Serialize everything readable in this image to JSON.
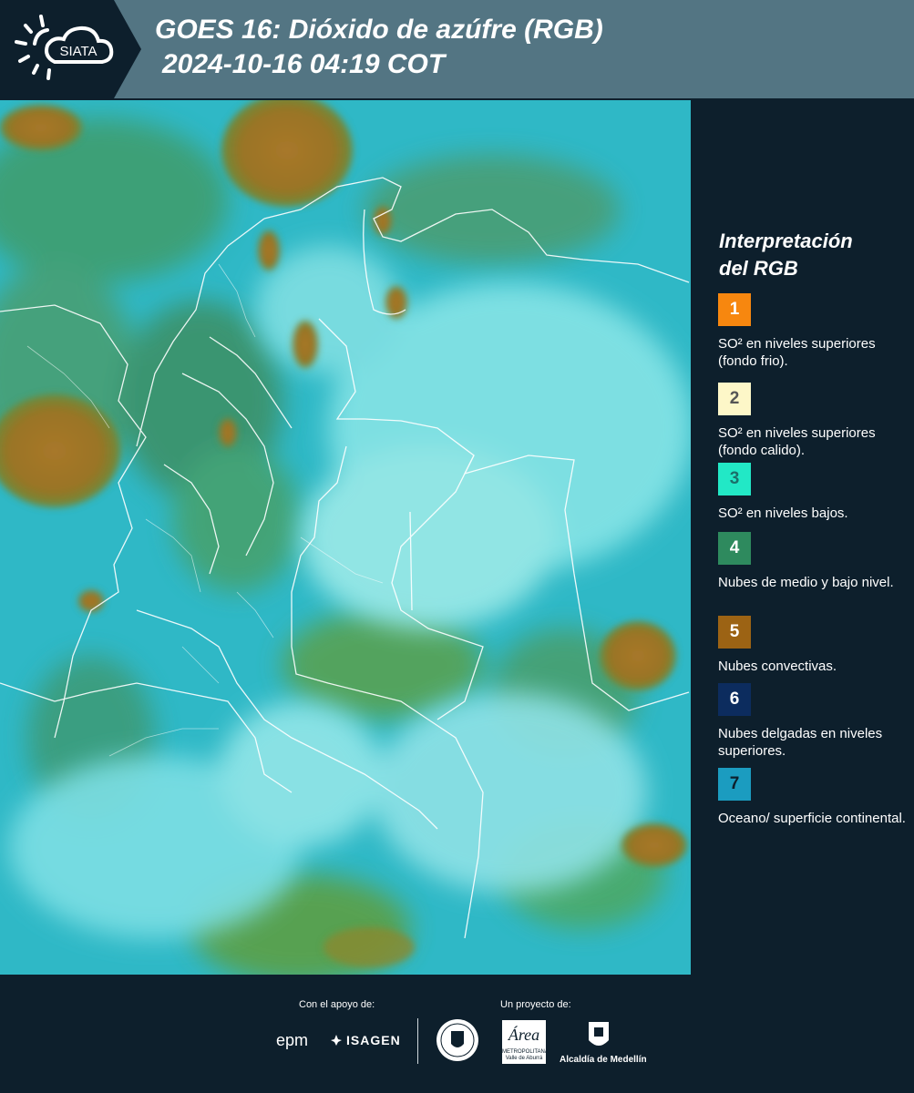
{
  "header": {
    "logo_text": "SIATA",
    "title_line1": "GOES 16: Dióxido de azúfre (RGB)",
    "title_line2": "2024-10-16 04:19 COT"
  },
  "legend": {
    "title_line1": "Interpretación",
    "title_line2": "del RGB",
    "items": [
      {
        "number": "1",
        "color": "#f7870f",
        "text": "SO² en niveles superiores (fondo frio)."
      },
      {
        "number": "2",
        "color": "#fdf7c8",
        "text": "SO² en niveles superiores (fondo calido)."
      },
      {
        "number": "3",
        "color": "#22e8c6",
        "text": "SO² en niveles bajos."
      },
      {
        "number": "4",
        "color": "#2e8a5e",
        "text": "Nubes de medio y bajo nivel."
      },
      {
        "number": "5",
        "color": "#9c6314",
        "text": "Nubes convectivas."
      },
      {
        "number": "6",
        "color": "#0c2c5e",
        "text": "Nubes delgadas en niveles superiores."
      },
      {
        "number": "7",
        "color": "#1b9cc0",
        "text": "Oceano/ superficie continental."
      }
    ]
  },
  "footer": {
    "support_label": "Con el apoyo de:",
    "project_label": "Un proyecto de:",
    "sponsors": {
      "epm": "epm",
      "isagen": "ISAGEN",
      "area_logo": "Área",
      "area_line1": "METROPOLITANA",
      "area_line2": "Valle de Aburrá",
      "alcaldia": "Alcaldía de Medellín"
    }
  },
  "colors": {
    "header_bg": "#537583",
    "panel_bg": "#0d1f2c",
    "ocean": "#29b9c9",
    "cloud_cyan": "#7de6e8",
    "cloud_green": "#4aa26a",
    "convective": "#9a7424"
  }
}
